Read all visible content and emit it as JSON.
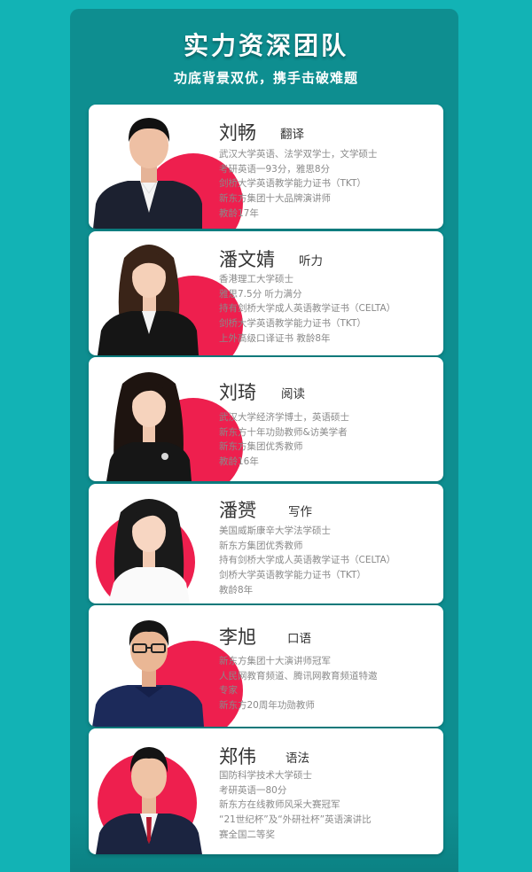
{
  "header": {
    "title": "实力资深团队",
    "subtitle": "功底背景双优，携手击破难题"
  },
  "colors": {
    "background": "#12b3b5",
    "panel": "#0e8e90",
    "accent_circle": "#ee1f4e",
    "card": "#ffffff"
  },
  "teachers": [
    {
      "name": "刘畅",
      "subject": "翻译",
      "lines": [
        "武汉大学英语、法学双学士，文学硕士",
        "考研英语一93分，雅思8分",
        "剑桥大学英语教学能力证书（TKT）",
        "新东方集团十大品牌演讲师",
        "教龄17年"
      ]
    },
    {
      "name": "潘文婧",
      "subject": "听力",
      "lines": [
        "香港理工大学硕士",
        "雅思7.5分 听力满分",
        "持有剑桥大学成人英语教学证书（CELTA）",
        "剑桥大学英语教学能力证书（TKT）",
        "上外高级口译证书 教龄8年"
      ]
    },
    {
      "name": "刘琦",
      "subject": "阅读",
      "lines": [
        "武汉大学经济学博士，英语硕士",
        "新东方十年功勋教师&访美学者",
        "新东方集团优秀教师",
        "教龄16年"
      ]
    },
    {
      "name": "潘赟",
      "subject": "写作",
      "lines": [
        "美国威斯康辛大学法学硕士",
        "新东方集团优秀教师",
        "持有剑桥大学成人英语教学证书（CELTA）",
        "剑桥大学英语教学能力证书（TKT）",
        "教龄8年"
      ]
    },
    {
      "name": "李旭",
      "subject": "口语",
      "lines": [
        "新东方集团十大演讲师冠军",
        "人民网教育频道、腾讯网教育频道特邀",
        "专家",
        "新东方20周年功勋教师"
      ]
    },
    {
      "name": "郑伟",
      "subject": "语法",
      "lines": [
        "国防科学技术大学硕士",
        "考研英语一80分",
        "新东方在线教师风采大赛冠军",
        "“21世纪杯”及“外研社杯”英语演讲比",
        "赛全国二等奖"
      ]
    }
  ]
}
